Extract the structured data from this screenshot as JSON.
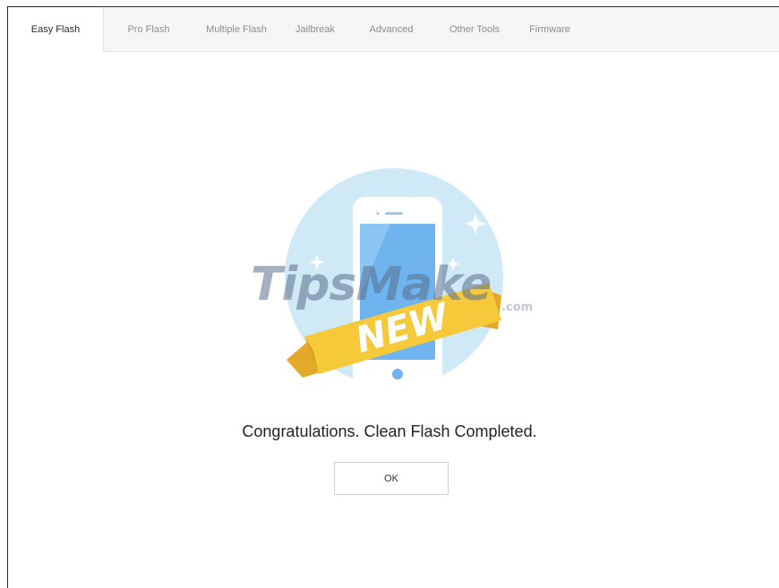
{
  "tabs": [
    {
      "label": "Easy Flash",
      "active": true
    },
    {
      "label": "Pro Flash",
      "active": false
    },
    {
      "label": "Multiple Flash",
      "active": false
    },
    {
      "label": "Jailbreak",
      "active": false
    },
    {
      "label": "Advanced",
      "active": false
    },
    {
      "label": "Other Tools",
      "active": false
    },
    {
      "label": "Firmware",
      "active": false
    }
  ],
  "illustration": {
    "ribbon_text": "NEW",
    "icon": "phone-new-icon",
    "colors": {
      "circle": "#cfe9f7",
      "phone_body": "#ffffff",
      "phone_screen": "#6fb4ef",
      "ribbon": "#f6c93b",
      "ribbon_text": "#ffffff"
    }
  },
  "watermark": {
    "text": "TipsMake",
    "suffix": ".com"
  },
  "dialog": {
    "message": "Congratulations. Clean Flash Completed.",
    "ok_label": "OK"
  }
}
